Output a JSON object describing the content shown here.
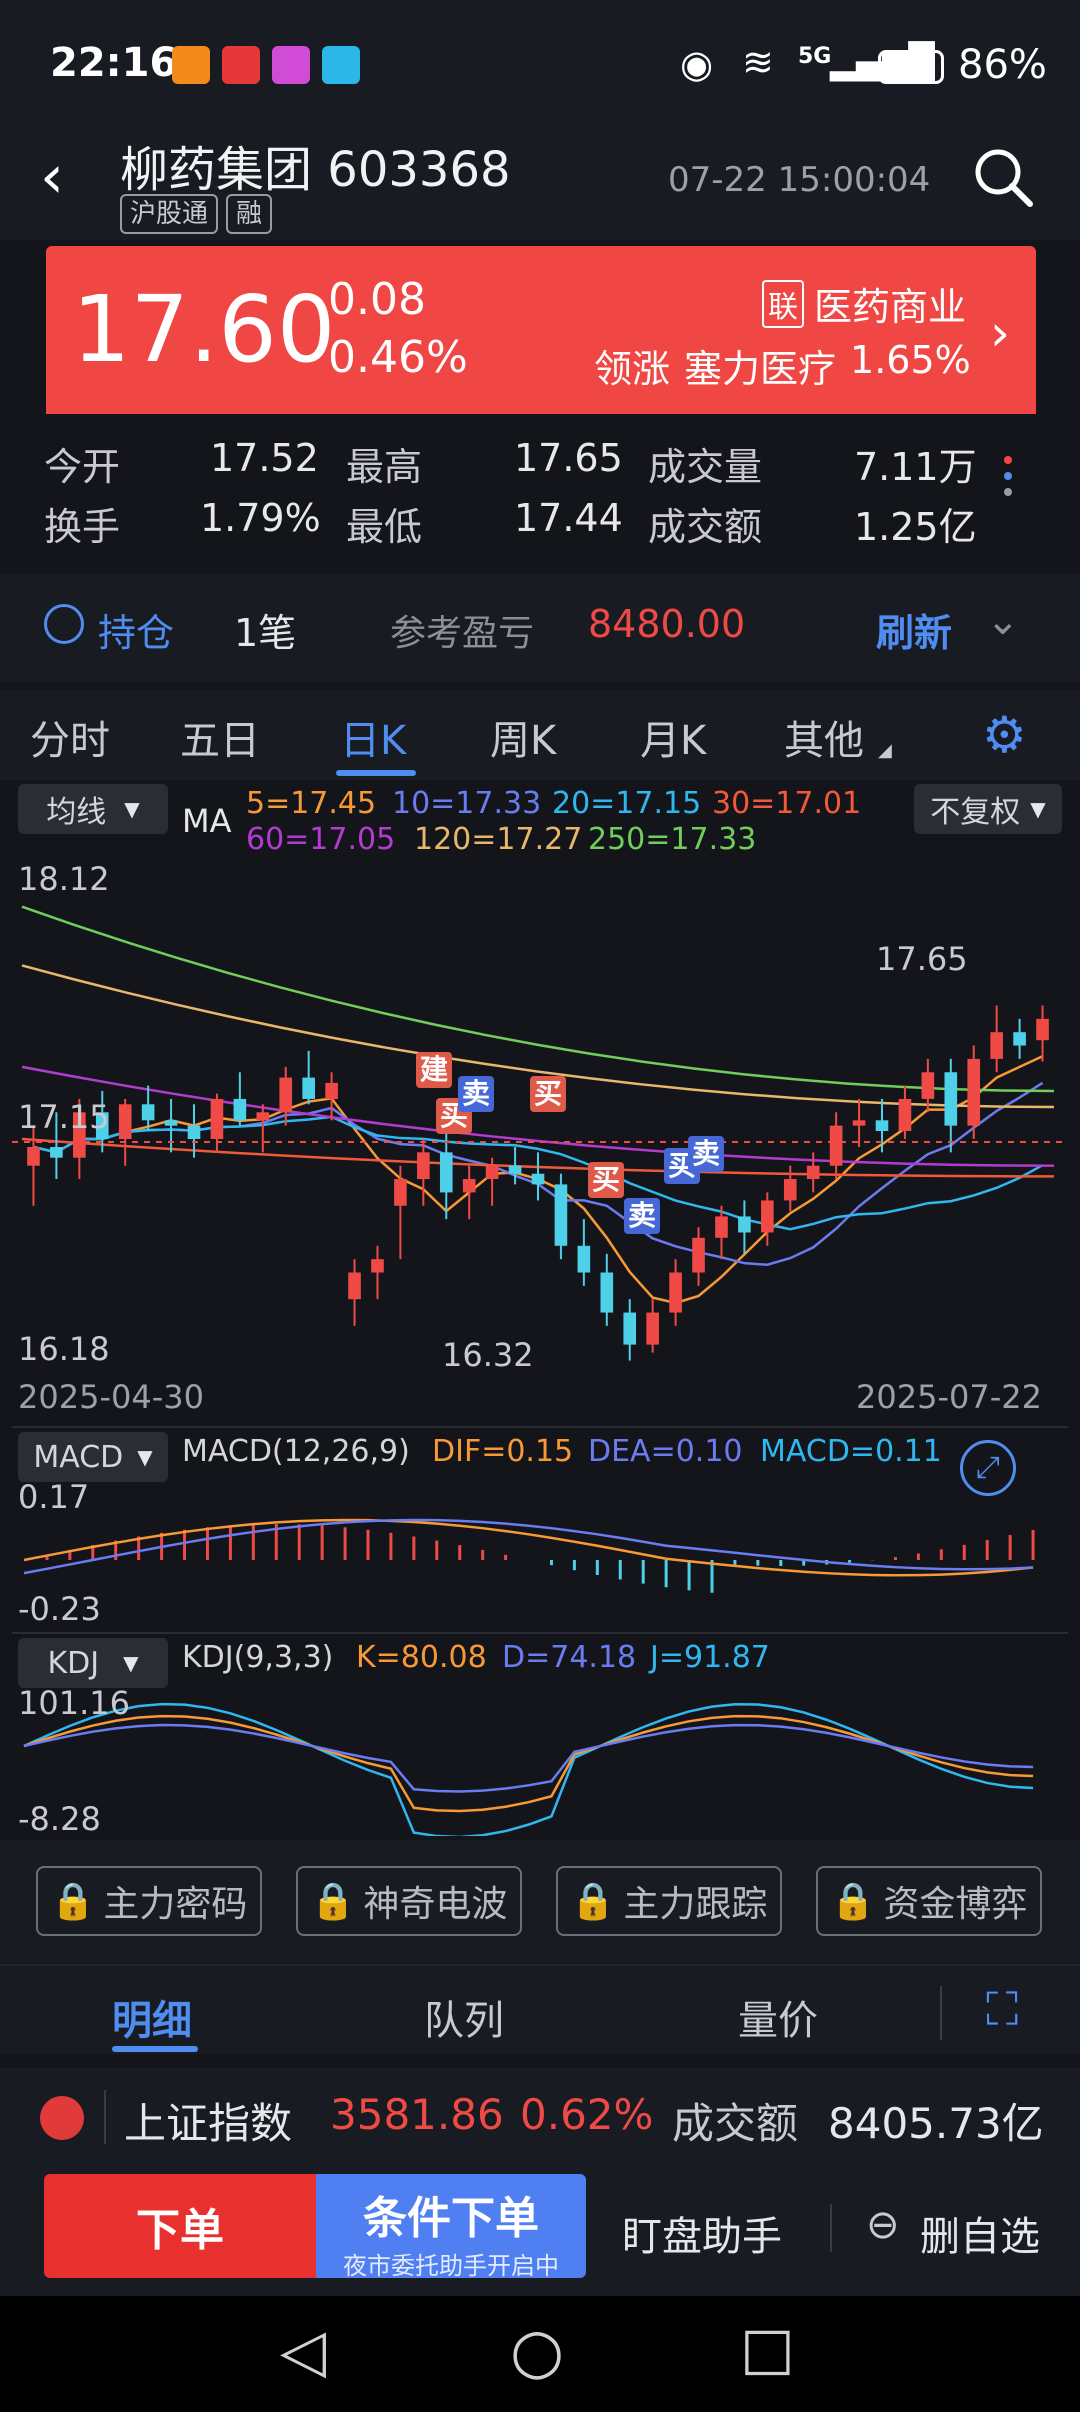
{
  "status": {
    "time": "22:16",
    "signal": "5G",
    "battery": "86%"
  },
  "header": {
    "name": "柳药集团",
    "code": "603368",
    "tags": [
      "沪股通",
      "融"
    ],
    "datetime": "07-22 15:00:04"
  },
  "quote": {
    "price": "17.60",
    "change": "0.08",
    "change_pct": "0.46%",
    "sector_tag": "联",
    "sector": "医药商业",
    "leader_label": "领涨",
    "leader": "塞力医疗",
    "leader_pct": "1.65%"
  },
  "stats": [
    {
      "l1": "今开",
      "v1": "17.52",
      "l2": "最高",
      "v2": "17.65",
      "l3": "成交量",
      "v3": "7.11万"
    },
    {
      "l1": "换手",
      "v1": "1.79%",
      "l2": "最低",
      "v2": "17.44",
      "l3": "成交额",
      "v3": "1.25亿"
    }
  ],
  "position": {
    "label": "持仓",
    "count": "1笔",
    "pl_label": "参考盈亏",
    "pl_value": "8480.00",
    "refresh": "刷新"
  },
  "tabs": [
    "分时",
    "五日",
    "日K",
    "周K",
    "月K",
    "其他"
  ],
  "active_tab": "日K",
  "ma": {
    "selector": "均线",
    "label": "MA",
    "ma5": "5=17.45",
    "ma10": "10=17.33",
    "ma20": "20=17.15",
    "ma30": "30=17.01",
    "ma60": "60=17.05",
    "ma120": "120=17.27",
    "ma250": "250=17.33",
    "adjust": "不复权"
  },
  "chart_labels": {
    "y_top": "18.12",
    "y_mid": "17.15",
    "y_bottom": "16.18",
    "high_label": "17.65",
    "low_label": "16.32",
    "date_start": "2025-04-30",
    "date_end": "2025-07-22"
  },
  "macd": {
    "selector": "MACD",
    "params": "MACD(12,26,9)",
    "dif": "DIF=0.15",
    "dea": "DEA=0.10",
    "macd": "MACD=0.11",
    "y_top": "0.17",
    "y_bottom": "-0.23"
  },
  "kdj": {
    "selector": "KDJ",
    "params": "KDJ(9,3,3)",
    "k": "K=80.08",
    "d": "D=74.18",
    "j": "J=91.87",
    "y_top": "101.16",
    "y_bottom": "-8.28"
  },
  "marks": [
    "建",
    "买",
    "卖",
    "买",
    "买",
    "卖",
    "买",
    "卖"
  ],
  "locked_buttons": [
    "主力密码",
    "神奇电波",
    "主力跟踪",
    "资金博弈"
  ],
  "bottom_tabs": [
    "明细",
    "队列",
    "量价"
  ],
  "index_bar": {
    "name": "上证指数",
    "value": "3581.86",
    "pct": "0.62%",
    "amount_label": "成交额",
    "amount": "8405.73亿"
  },
  "actions": {
    "order": "下单",
    "cond_order": "条件下单",
    "cond_sub": "夜市委托助手开启中",
    "watch": "盯盘助手",
    "remove": "删自选"
  },
  "chart_data": {
    "type": "candlestick",
    "ylim": [
      16.18,
      18.12
    ],
    "ohlc": [
      [
        17.05,
        17.2,
        16.9,
        17.12
      ],
      [
        17.12,
        17.25,
        17.0,
        17.08
      ],
      [
        17.08,
        17.3,
        17.0,
        17.25
      ],
      [
        17.25,
        17.33,
        17.1,
        17.15
      ],
      [
        17.15,
        17.3,
        17.05,
        17.28
      ],
      [
        17.28,
        17.35,
        17.18,
        17.22
      ],
      [
        17.22,
        17.3,
        17.1,
        17.2
      ],
      [
        17.2,
        17.28,
        17.08,
        17.15
      ],
      [
        17.15,
        17.32,
        17.1,
        17.3
      ],
      [
        17.3,
        17.4,
        17.2,
        17.22
      ],
      [
        17.22,
        17.28,
        17.1,
        17.25
      ],
      [
        17.25,
        17.42,
        17.2,
        17.38
      ],
      [
        17.38,
        17.48,
        17.28,
        17.3
      ],
      [
        17.3,
        17.4,
        17.22,
        17.36
      ],
      [
        16.55,
        16.7,
        16.45,
        16.65
      ],
      [
        16.65,
        16.75,
        16.55,
        16.7
      ],
      [
        16.9,
        17.05,
        16.7,
        17.0
      ],
      [
        17.0,
        17.15,
        16.9,
        17.1
      ],
      [
        17.1,
        17.18,
        16.85,
        16.95
      ],
      [
        16.95,
        17.05,
        16.85,
        17.0
      ],
      [
        17.0,
        17.08,
        16.9,
        17.05
      ],
      [
        17.05,
        17.12,
        16.98,
        17.02
      ],
      [
        17.02,
        17.1,
        16.92,
        16.98
      ],
      [
        16.98,
        17.02,
        16.7,
        16.75
      ],
      [
        16.75,
        16.85,
        16.6,
        16.65
      ],
      [
        16.65,
        16.72,
        16.45,
        16.5
      ],
      [
        16.5,
        16.55,
        16.32,
        16.38
      ],
      [
        16.38,
        16.55,
        16.35,
        16.5
      ],
      [
        16.5,
        16.7,
        16.45,
        16.65
      ],
      [
        16.65,
        16.82,
        16.6,
        16.78
      ],
      [
        16.78,
        16.9,
        16.7,
        16.86
      ],
      [
        16.86,
        16.92,
        16.72,
        16.8
      ],
      [
        16.8,
        16.95,
        16.75,
        16.92
      ],
      [
        16.92,
        17.05,
        16.88,
        17.0
      ],
      [
        17.0,
        17.1,
        16.95,
        17.05
      ],
      [
        17.05,
        17.25,
        17.0,
        17.2
      ],
      [
        17.2,
        17.3,
        17.12,
        17.22
      ],
      [
        17.22,
        17.3,
        17.1,
        17.18
      ],
      [
        17.18,
        17.35,
        17.15,
        17.3
      ],
      [
        17.3,
        17.45,
        17.25,
        17.4
      ],
      [
        17.4,
        17.45,
        17.1,
        17.2
      ],
      [
        17.2,
        17.5,
        17.15,
        17.45
      ],
      [
        17.45,
        17.65,
        17.4,
        17.55
      ],
      [
        17.55,
        17.6,
        17.45,
        17.5
      ],
      [
        17.52,
        17.65,
        17.44,
        17.6
      ]
    ]
  }
}
